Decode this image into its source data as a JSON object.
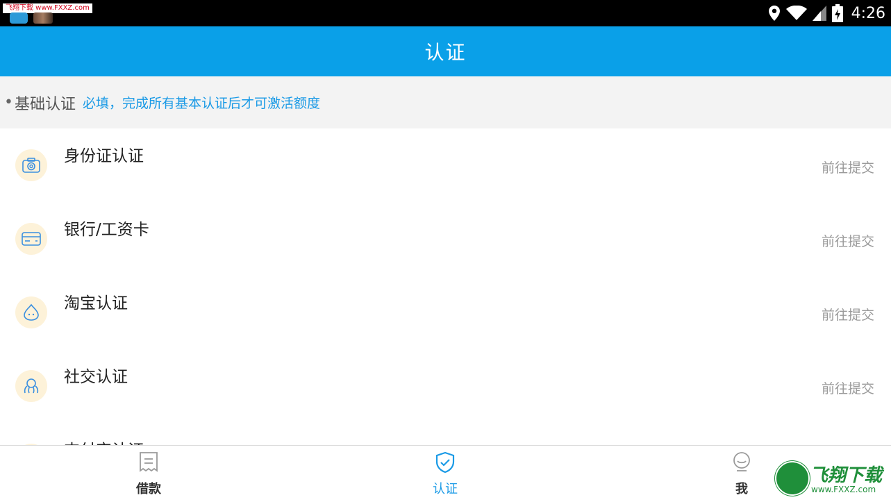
{
  "status_bar": {
    "watermark": "飞翔下载 www.FXXZ.com",
    "time": "4:26",
    "icons": [
      "location-icon",
      "wifi-icon",
      "signal-icon",
      "battery-icon"
    ]
  },
  "header": {
    "title": "认证"
  },
  "section": {
    "bullet": "•",
    "title": "基础认证",
    "note": "必填，完成所有基本认证后才可激活额度"
  },
  "items": [
    {
      "label": "身份证认证",
      "action": "前往提交",
      "icon": "camera-icon"
    },
    {
      "label": "银行/工资卡",
      "action": "前往提交",
      "icon": "bank-card-icon"
    },
    {
      "label": "淘宝认证",
      "action": "前往提交",
      "icon": "taobao-icon"
    },
    {
      "label": "社交认证",
      "action": "前往提交",
      "icon": "social-icon"
    },
    {
      "label": "支付宝认证",
      "action": "",
      "icon": "alipay-icon"
    }
  ],
  "bottom_nav": {
    "tabs": [
      {
        "label": "借款",
        "icon": "document-icon",
        "active": false
      },
      {
        "label": "认证",
        "icon": "shield-check-icon",
        "active": true
      },
      {
        "label": "我",
        "icon": "user-icon",
        "active": false
      }
    ]
  },
  "corner_logo": {
    "text": "飞翔下载",
    "url": "www.FXXZ.com"
  },
  "colors": {
    "accent": "#0aa0e8",
    "link": "#1a9ae6",
    "icon_bg": "#fdf2d9"
  }
}
